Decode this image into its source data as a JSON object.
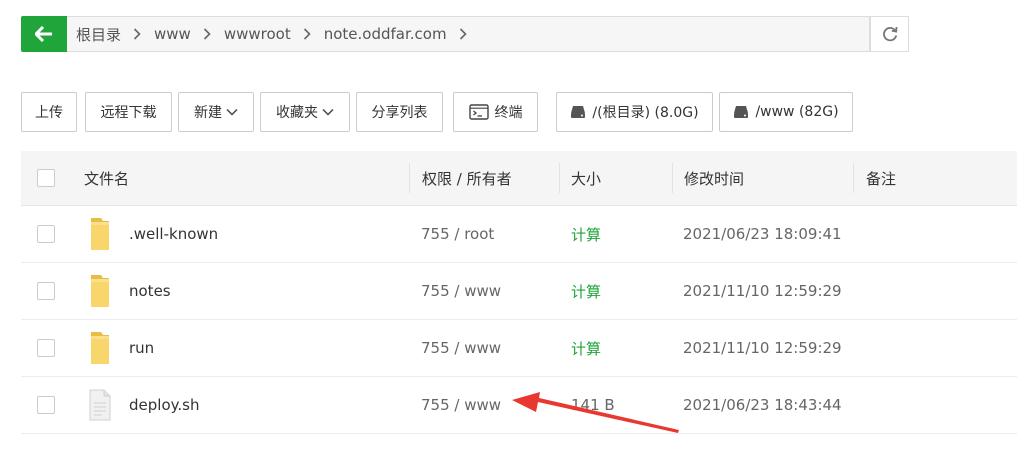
{
  "breadcrumb": {
    "items": [
      "根目录",
      "www",
      "wwwroot",
      "note.oddfar.com"
    ]
  },
  "toolbar": {
    "upload": "上传",
    "remote_download": "远程下载",
    "new": "新建",
    "favorites": "收藏夹",
    "share_list": "分享列表",
    "terminal": "终端",
    "disk_root": "/(根目录) (8.0G)",
    "disk_www": "/www (82G)"
  },
  "table": {
    "headers": {
      "name": "文件名",
      "perm_owner": "权限 / 所有者",
      "size": "大小",
      "mtime": "修改时间",
      "note": "备注"
    },
    "rows": [
      {
        "type": "folder",
        "name": ".well-known",
        "perm": "755 / root",
        "size": "计算",
        "mtime": "2021/06/23 18:09:41",
        "note": ""
      },
      {
        "type": "folder",
        "name": "notes",
        "perm": "755 / www",
        "size": "计算",
        "mtime": "2021/11/10 12:59:29",
        "note": ""
      },
      {
        "type": "folder",
        "name": "run",
        "perm": "755 / www",
        "size": "计算",
        "mtime": "2021/11/10 12:59:29",
        "note": ""
      },
      {
        "type": "file",
        "name": "deploy.sh",
        "perm": "755 / www",
        "size": "141 B",
        "mtime": "2021/06/23 18:43:44",
        "note": ""
      }
    ]
  },
  "colors": {
    "accent_green": "#20a53a",
    "annotation_arrow": "#e8382f"
  }
}
